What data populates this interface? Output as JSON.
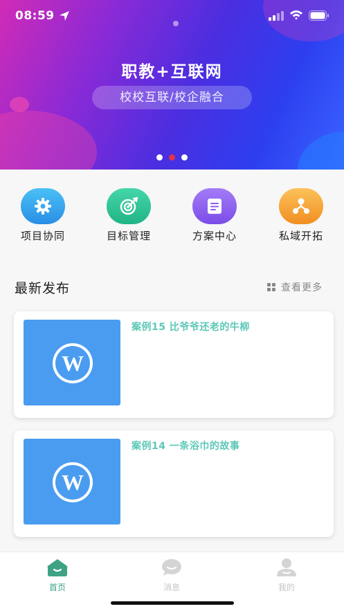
{
  "status_bar": {
    "time": "08:59"
  },
  "banner": {
    "title": "职教+互联网",
    "subtitle": "校校互联/校企融合",
    "carousel_active_index": 1,
    "carousel_count": 3
  },
  "quick_menu": [
    {
      "label": "项目协同",
      "icon": "gear-icon",
      "color": "#3aa9f0"
    },
    {
      "label": "目标管理",
      "icon": "target-icon",
      "color": "#2ec89a"
    },
    {
      "label": "方案中心",
      "icon": "document-icon",
      "color": "#8a5cf0"
    },
    {
      "label": "私域开拓",
      "icon": "network-icon",
      "color": "#f4a53a"
    }
  ],
  "section": {
    "title": "最新发布",
    "more_label": "查看更多"
  },
  "articles": [
    {
      "title": "案例15 比爷爷还老的牛柳"
    },
    {
      "title": "案例14 一条浴巾的故事"
    }
  ],
  "tabbar": [
    {
      "label": "首页",
      "icon": "home-icon",
      "active": true
    },
    {
      "label": "消息",
      "icon": "message-icon",
      "active": false
    },
    {
      "label": "我的",
      "icon": "user-icon",
      "active": false
    }
  ],
  "colors": {
    "accent": "#3ea385",
    "card_title": "#5cc8b7",
    "thumb": "#4a9cf0",
    "carousel_active": "#e0334a"
  }
}
